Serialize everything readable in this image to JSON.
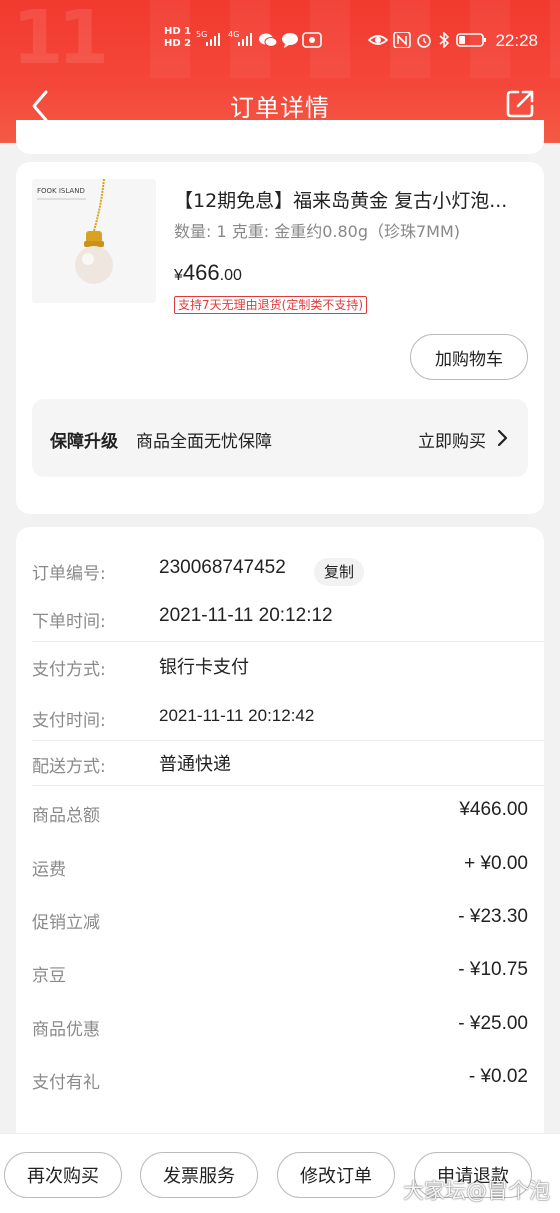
{
  "status_bar": {
    "sim1": "HD 1",
    "sim2": "HD 2",
    "net1": "5G",
    "net2": "4G",
    "time": "22:28"
  },
  "nav": {
    "title": "订单详情"
  },
  "product": {
    "brand_logo_text": "FOOK ISLAND",
    "name": "【12期免息】福来岛黄金 复古小灯泡...",
    "spec": "数量: 1   克重: 金重约0.80g（珍珠7MM)",
    "price_currency": "¥",
    "price_int": "466",
    "price_dec": ".00",
    "return_policy": "支持7天无理由退货(定制类不支持)",
    "add_cart_label": "加购物车"
  },
  "guarantee": {
    "title": "保障升级",
    "desc": "商品全面无忧保障",
    "buy_label": "立即购买"
  },
  "order_info": {
    "order_no_label": "订单编号:",
    "order_no": "230068747452",
    "copy_label": "复制",
    "order_time_label": "下单时间:",
    "order_time": "2021-11-11 20:12:12",
    "pay_method_label": "支付方式:",
    "pay_method": "银行卡支付",
    "pay_time_label": "支付时间:",
    "pay_time": "2021-11-11 20:12:42",
    "delivery_label": "配送方式:",
    "delivery": "普通快递"
  },
  "amounts": [
    {
      "label": "商品总额",
      "value": "¥466.00"
    },
    {
      "label": "运费",
      "value": "+ ¥0.00"
    },
    {
      "label": "促销立减",
      "value": "- ¥23.30"
    },
    {
      "label": "京豆",
      "value": "- ¥10.75"
    },
    {
      "label": "商品优惠",
      "value": "- ¥25.00"
    },
    {
      "label": "支付有礼",
      "value": "- ¥0.02"
    }
  ],
  "actions": {
    "rebuy": "再次购买",
    "invoice": "发票服务",
    "modify": "修改订单",
    "refund": "申请退款"
  },
  "watermark": "大家坛@冒个泡",
  "colors": {
    "brand_red": "#f23a2f",
    "accent_red": "#e4393c"
  }
}
